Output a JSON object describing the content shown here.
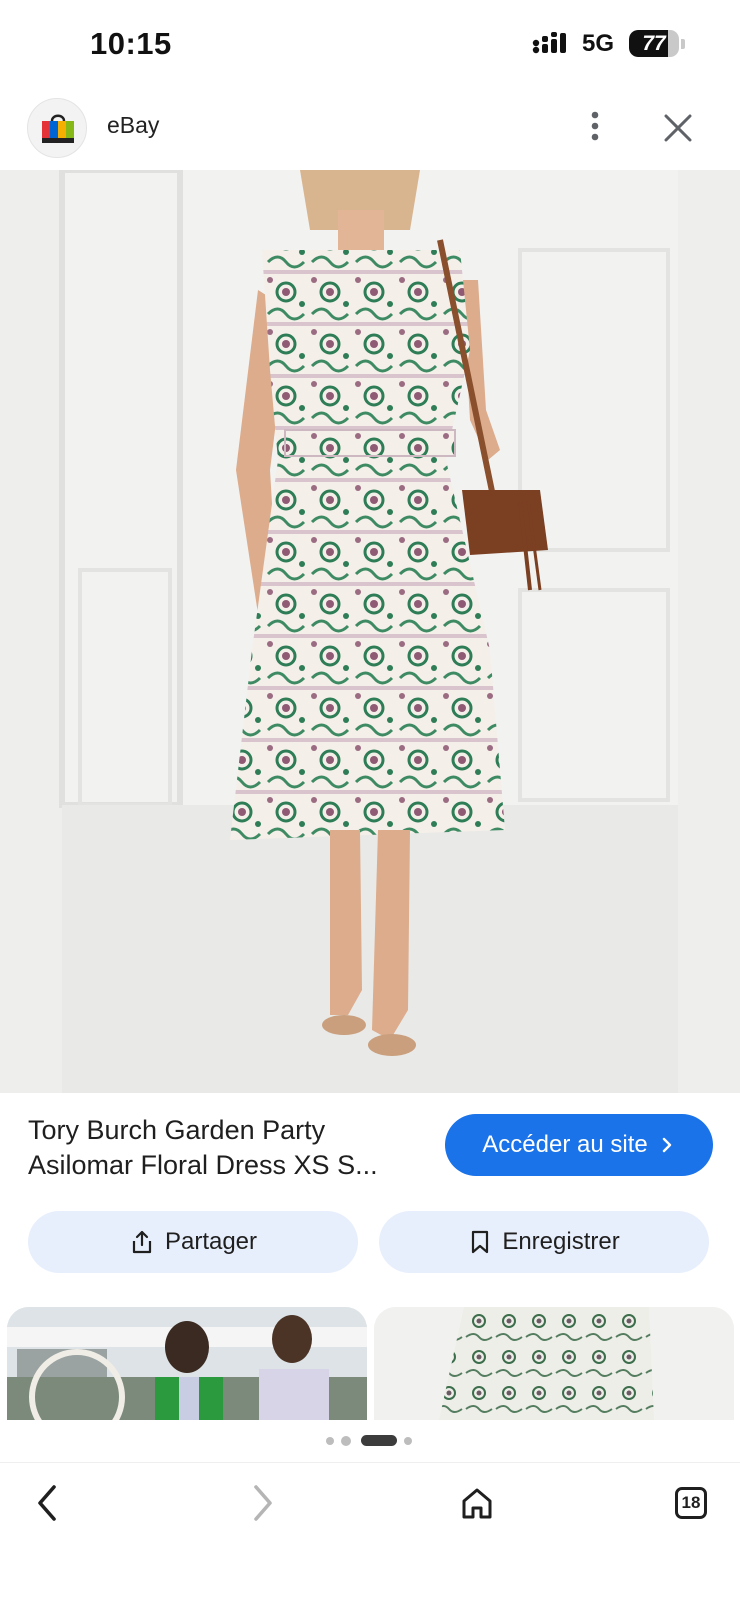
{
  "status_bar": {
    "time": "10:15",
    "network": "5G",
    "battery_level": "77",
    "battery_fraction": 0.77
  },
  "header": {
    "site_name": "eBay",
    "logo_icon": "shopping-bag-icon",
    "more_icon": "more-vert-icon",
    "close_icon": "close-icon"
  },
  "product": {
    "title": "Tory Burch Garden Party Asilomar Floral Dress XS S...",
    "visit_label": "Accéder au site",
    "accent_color": "#1a73e8"
  },
  "actions": {
    "share_label": "Partager",
    "save_label": "Enregistrer"
  },
  "pager": {
    "count": 4,
    "active_index": 2
  },
  "nav": {
    "back_icon": "chevron-left-icon",
    "forward_icon": "chevron-right-icon",
    "home_icon": "home-icon",
    "tabs_count": "18"
  }
}
